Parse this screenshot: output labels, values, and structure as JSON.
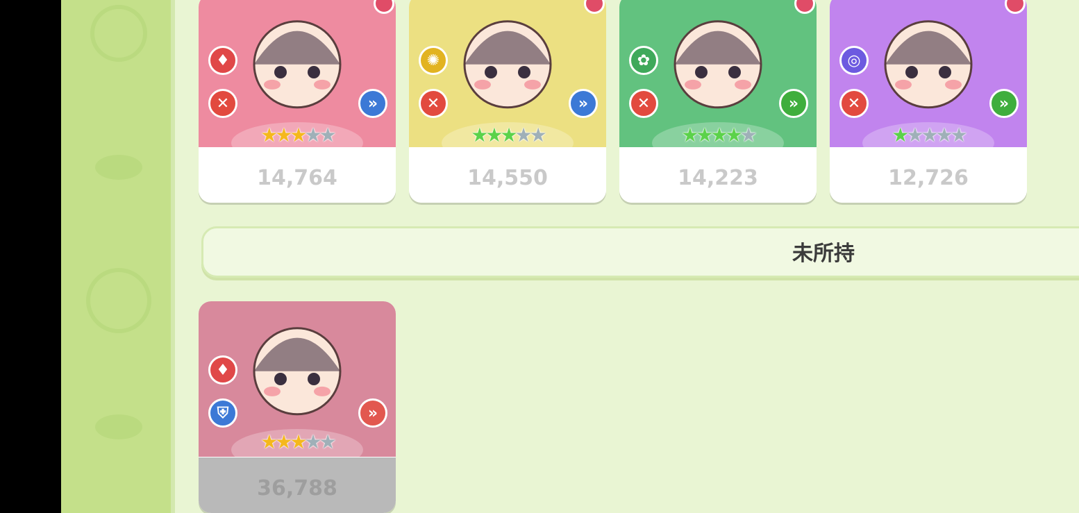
{
  "owned_cards": [
    {
      "value": "14,764",
      "element_icon": "fire-element-icon",
      "class_icon": "close-combat-icon",
      "role_icon": "advance-icon",
      "stars_filled": 3,
      "stars_total": 5,
      "star_color": "gold",
      "bg": "#ee8ba0"
    },
    {
      "value": "14,550",
      "element_icon": "light-element-icon",
      "class_icon": "close-combat-icon",
      "role_icon": "advance-icon",
      "stars_filled": 3,
      "stars_total": 5,
      "star_color": "green",
      "bg": "#ece082"
    },
    {
      "value": "14,223",
      "element_icon": "leaf-element-icon",
      "class_icon": "close-combat-icon",
      "role_icon": "advance-icon",
      "stars_filled": 4,
      "stars_total": 5,
      "star_color": "green",
      "bg": "#62c27f"
    },
    {
      "value": "12,726",
      "element_icon": "swirl-element-icon",
      "class_icon": "close-combat-icon",
      "role_icon": "advance-icon",
      "stars_filled": 1,
      "stars_total": 5,
      "star_color": "green",
      "bg": "#c184ee"
    }
  ],
  "section": {
    "unowned_label": "未所持"
  },
  "unowned_cards": [
    {
      "value": "36,788",
      "element_icon": "fire-element-icon",
      "class_icon": "shield-icon",
      "role_icon": "advance-icon",
      "stars_filled": 3,
      "stars_total": 5,
      "star_color": "gold",
      "bg": "#d8899c"
    }
  ],
  "colors": {
    "side_strip": "#c4e08a",
    "main_bg": "#e9f5d3",
    "gold_star": "#f5b81c",
    "green_star": "#5bd24a",
    "empty_star": "#9fb0b8"
  }
}
